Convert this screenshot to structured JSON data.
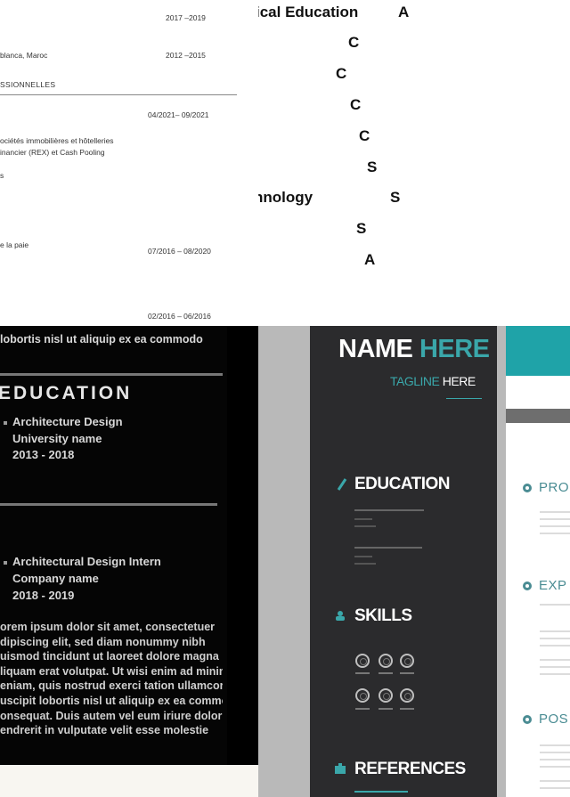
{
  "fr_resume": {
    "years_1": "2017 –2019",
    "location": "blanca, Maroc",
    "years_2": "2012 –2015",
    "section_heading": "SSIONNELLES",
    "date_1": "04/2021– 09/2021",
    "text_1": "ociétés immobilières et hôtelleries",
    "text_2": "inancier (REX) et Cash Pooling",
    "text_3": "s",
    "text_4": "e la paie",
    "date_2": "07/2016 – 08/2020",
    "date_3": "02/2016 – 06/2016"
  },
  "grades": {
    "row_1_label": "ical Education",
    "row_1_grade": "A",
    "row_2_grade": "C",
    "row_3_grade": "C",
    "row_4_grade": "C",
    "row_5_grade": "C",
    "row_6_grade": "S",
    "row_7_label": "hnology",
    "row_7_grade": "S",
    "row_8_grade": "S",
    "row_9_grade": "A"
  },
  "dark_resume": {
    "top_line": "lobortis nisl ut aliquip ex ea commodo",
    "education_heading": "EDUCATION",
    "edu_title": "Architecture Design",
    "edu_school": "University name",
    "edu_years": "2013 - 2018",
    "exp_title": "Architectural Design Intern",
    "exp_company": "Company name",
    "exp_years": "2018 - 2019",
    "exp_lines": [
      "orem ipsum dolor sit amet, consectetuer",
      "dipiscing elit, sed diam nonummy nibh",
      "uismod tincidunt ut laoreet dolore magna",
      "liquam erat volutpat. Ut wisi enim ad minim",
      "eniam, quis nostrud exerci tation ullamcorper",
      "uscipit lobortis nisl ut aliquip ex ea commodo",
      "onsequat. Duis autem vel eum iriure dolor in",
      "endrerit in vulputate velit esse molestie"
    ]
  },
  "teal_template": {
    "name_part_1": "NAME",
    "name_part_2": "HERE",
    "tagline_1": "TAGLINE",
    "tagline_2": "HERE",
    "education_heading": "EDUCATION",
    "skills_heading": "SKILLS",
    "references_heading": "REFERENCES",
    "right_heading_1": "PRO",
    "right_heading_2": "EXP",
    "right_heading_3": "POS",
    "colors": {
      "teal": "#1fa3a8",
      "dark": "#2b2b2d"
    }
  }
}
